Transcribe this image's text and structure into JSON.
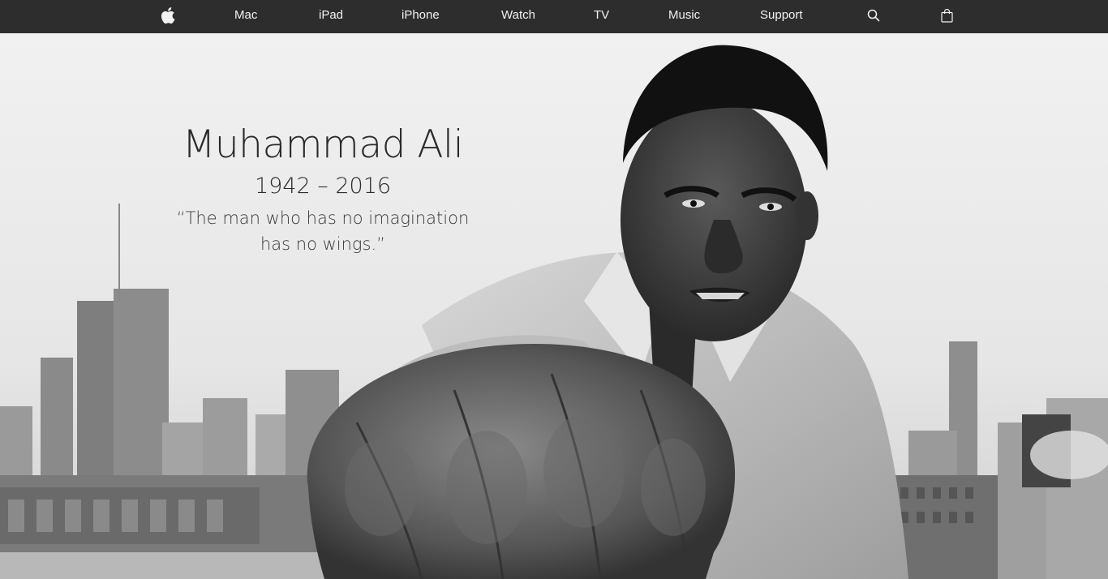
{
  "nav": {
    "logo_icon": "apple-logo-icon",
    "items": [
      {
        "label": "Mac"
      },
      {
        "label": "iPad"
      },
      {
        "label": "iPhone"
      },
      {
        "label": "Watch"
      },
      {
        "label": "TV"
      },
      {
        "label": "Music"
      },
      {
        "label": "Support"
      }
    ],
    "search_icon": "search-icon",
    "bag_icon": "shopping-bag-icon",
    "background": "#2d2d2d",
    "text_color": "#f2f2f2"
  },
  "hero": {
    "title": "Muhammad Ali",
    "years": "1942 – 2016",
    "quote_line1": "“The man who has no imagination",
    "quote_line2": "has no wings.”",
    "image": "black-and-white-boxer-fist-photo"
  }
}
